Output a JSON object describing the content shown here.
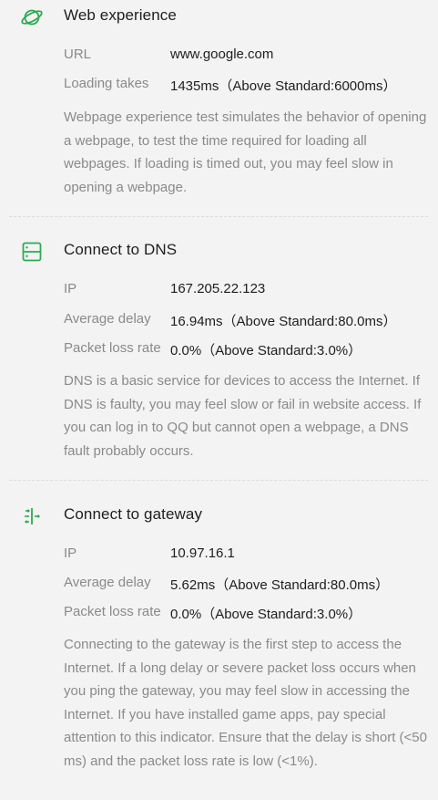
{
  "accent_color": "#2eaa54",
  "sections": [
    {
      "icon": "planet-icon",
      "title": "Web experience",
      "rows": [
        {
          "label": "URL",
          "value": "www.google.com"
        },
        {
          "label": "Loading takes",
          "value": "1435ms（Above Standard:6000ms）"
        }
      ],
      "description": "Webpage experience test simulates the behavior of opening a webpage, to test the time required for loading all webpages. If loading is timed out, you may feel slow in opening a webpage."
    },
    {
      "icon": "dns-server-icon",
      "title": "Connect to DNS",
      "rows": [
        {
          "label": "IP",
          "value": "167.205.22.123"
        },
        {
          "label": "Average delay",
          "value": "16.94ms（Above Standard:80.0ms）"
        },
        {
          "label": "Packet loss rate",
          "value": "0.0%（Above Standard:3.0%）"
        }
      ],
      "description": "DNS is a basic service for devices to access the Internet. If DNS is faulty, you may feel slow or fail in website access. If you can log in to QQ but cannot open a webpage, a DNS fault probably occurs."
    },
    {
      "icon": "gateway-arrows-icon",
      "title": "Connect to gateway",
      "rows": [
        {
          "label": "IP",
          "value": "10.97.16.1"
        },
        {
          "label": "Average delay",
          "value": "5.62ms（Above Standard:80.0ms）"
        },
        {
          "label": "Packet loss rate",
          "value": "0.0%（Above Standard:3.0%）"
        }
      ],
      "description": "Connecting to the gateway is the first step to access the Internet. If a long delay or severe packet loss occurs when you ping the gateway, you may feel slow in accessing the Internet. If you have installed game apps, pay special attention to this indicator. Ensure that the delay is short (<50 ms) and the packet loss rate is low (<1%)."
    }
  ]
}
